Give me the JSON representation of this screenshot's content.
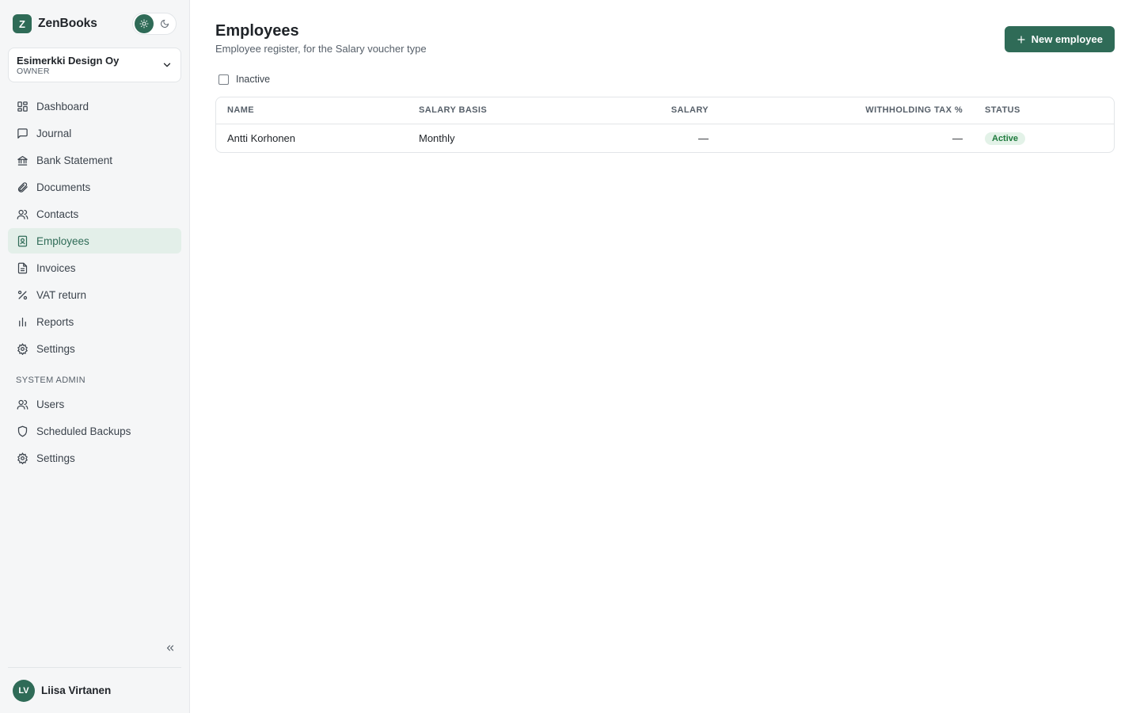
{
  "brand": {
    "logo_letter": "Z",
    "name": "ZenBooks"
  },
  "organization": {
    "name": "Esimerkki Design Oy",
    "role": "OWNER"
  },
  "nav": {
    "items": [
      {
        "label": "Dashboard",
        "icon": "grid-icon"
      },
      {
        "label": "Journal",
        "icon": "message-square-icon"
      },
      {
        "label": "Bank Statement",
        "icon": "bank-icon"
      },
      {
        "label": "Documents",
        "icon": "paperclip-icon"
      },
      {
        "label": "Contacts",
        "icon": "users-icon"
      },
      {
        "label": "Employees",
        "icon": "badge-user-icon",
        "active": true
      },
      {
        "label": "Invoices",
        "icon": "file-icon"
      },
      {
        "label": "VAT return",
        "icon": "percent-icon"
      },
      {
        "label": "Reports",
        "icon": "bar-chart-icon"
      },
      {
        "label": "Settings",
        "icon": "gear-icon"
      }
    ],
    "admin_label": "SYSTEM ADMIN",
    "admin_items": [
      {
        "label": "Users",
        "icon": "users-icon"
      },
      {
        "label": "Scheduled Backups",
        "icon": "shield-icon"
      },
      {
        "label": "Settings",
        "icon": "gear-icon"
      }
    ]
  },
  "user": {
    "initials": "LV",
    "name": "Liisa Virtanen"
  },
  "page": {
    "title": "Employees",
    "subtitle": "Employee register, for the Salary voucher type",
    "new_button_label": "New employee",
    "filter_label": "Inactive"
  },
  "table": {
    "headers": [
      "NAME",
      "SALARY BASIS",
      "SALARY",
      "WITHHOLDING TAX %",
      "STATUS"
    ],
    "rows": [
      {
        "name": "Antti Korhonen",
        "basis": "Monthly",
        "salary": "—",
        "tax": "—",
        "status": "Active"
      }
    ]
  },
  "colors": {
    "accent": "#2f6b57",
    "active_nav_bg": "#e3efe9",
    "badge_bg": "#e3f2e8",
    "badge_text": "#1e7a3d"
  }
}
